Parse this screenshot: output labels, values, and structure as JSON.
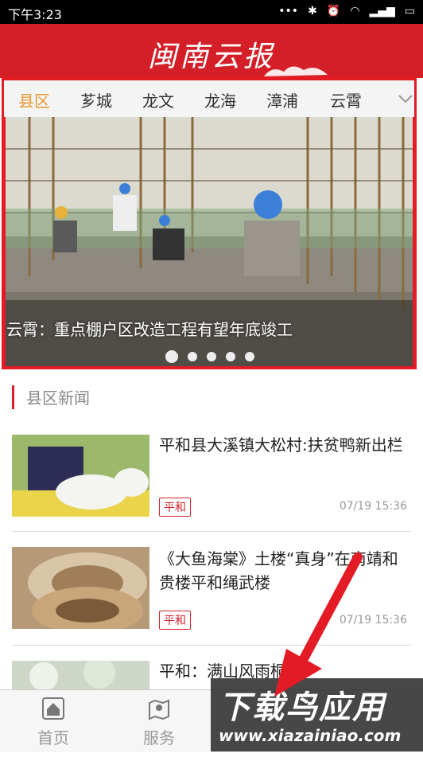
{
  "status_bar": {
    "time": "下午3:23"
  },
  "header": {
    "title": "闽南云报"
  },
  "tabs": [
    "县区",
    "芗城",
    "龙文",
    "龙海",
    "漳浦",
    "云霄"
  ],
  "banner": {
    "caption": "云霄：重点棚户区改造工程有望年底竣工",
    "slide_count": 5,
    "active_slide": 1
  },
  "section": {
    "title": "县区新闻"
  },
  "news": [
    {
      "title": "平和县大溪镇大松村:扶贫鸭新出栏",
      "tag": "平和",
      "time": "07/19 15:36"
    },
    {
      "title": "《大鱼海棠》土楼“真身”在南靖和贵楼平和绳武楼",
      "tag": "平和",
      "time": "07/19 15:36"
    },
    {
      "title": "平和：满山风雨桐花"
    }
  ],
  "bottom_nav": [
    {
      "label": "首页"
    },
    {
      "label": "服务"
    }
  ],
  "watermark": {
    "big": "下载鸟应用",
    "small": "www.xiazainiao.com"
  },
  "colors": {
    "brand_red": "#d51f28",
    "active_tab": "#e8972f"
  }
}
